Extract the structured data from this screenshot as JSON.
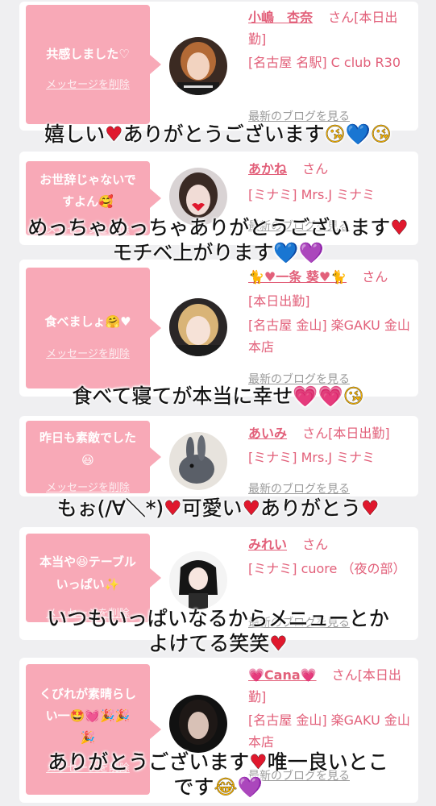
{
  "cards": [
    {
      "bubble_lines": [
        "共感しました♡"
      ],
      "delete_label": "メッセージを削除",
      "name": "小嶋　杏奈",
      "san": "さん",
      "badge": "[本日出勤]",
      "shop": "[名古屋 名駅] C club R30",
      "blog": "最新のブログを見る",
      "avatar_desc": "woman with brown hair"
    },
    {
      "bubble_lines": [
        "お世辞じゃないで",
        "すよん🥰"
      ],
      "delete_label": "メッセージを削除",
      "name": "あかね",
      "san": "さん",
      "badge": "",
      "shop": "[ミナミ] Mrs.J ミナミ",
      "blog": "最新のブログを見る",
      "avatar_desc": "woman with heart filter"
    },
    {
      "bubble_lines": [
        "食べましょ🤗♥"
      ],
      "delete_label": "メッセージを削除",
      "name": "🐈♥一条 葵♥🐈",
      "san": "さん",
      "badge": "[本日出勤]",
      "shop": "[名古屋 金山] 楽GAKU 金山本店",
      "blog": "最新のブログを見る",
      "avatar_desc": "blonde woman"
    },
    {
      "bubble_lines": [
        "昨日も素敵でした",
        "😃"
      ],
      "delete_label": "メッセージを削除",
      "name": "あいみ",
      "san": "さん",
      "badge": "[本日出勤]",
      "shop": "[ミナミ] Mrs.J ミナミ",
      "blog": "最新のブログを見る",
      "avatar_desc": "grey rabbit"
    },
    {
      "bubble_lines": [
        "本当や😆テーブル",
        "いっぱい✨"
      ],
      "delete_label": "メッセージを削除",
      "name": "みれい",
      "san": "さん",
      "badge": "",
      "shop": "[ミナミ] cuore （夜の部）",
      "blog": "最新のブログを見る",
      "avatar_desc": "anime character"
    },
    {
      "bubble_lines": [
        "くびれが素晴らし",
        "い一🤩💓🎉🎉",
        "🎉"
      ],
      "delete_label": "メッセージを削除",
      "name": "💗Cana💗",
      "san": "さん",
      "badge": "[本日出勤]",
      "shop": "[名古屋 金山] 楽GAKU 金山本店",
      "blog": "最新のブログを見る",
      "avatar_desc": "woman with dark hair"
    }
  ],
  "captions": [
    [
      "嬉しい",
      "♥",
      "ありがとうございます",
      "😘",
      "💙",
      "😘"
    ],
    [
      "めっちゃめっちゃありがとうございます",
      "♥",
      "モチベ上がります",
      "💙",
      "💜"
    ],
    [
      "食べて寝てが本当に幸せ",
      "💗",
      "💗",
      "😘"
    ],
    [
      "もぉ(/∀＼*)",
      "♥",
      "可愛い",
      "♥",
      "ありがとう",
      "♥"
    ],
    [
      "いつもいっぱいなるからメニューとか",
      "よけてる笑笑",
      "♥"
    ],
    [
      "ありがとうございます",
      "♥",
      "唯一良いとこ",
      "です",
      "😂",
      "💜"
    ]
  ]
}
